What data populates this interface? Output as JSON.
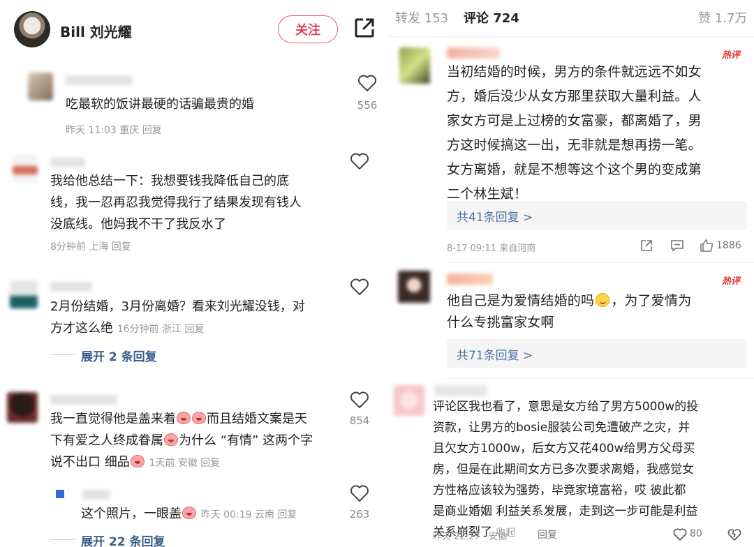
{
  "left": {
    "author": "Bill 刘光耀",
    "follow_label": "关注",
    "comments": [
      {
        "text": "吃最软的饭讲最硬的话骗最贵的婚",
        "meta": "昨天 11:03 重庆 回复",
        "likes": "556"
      },
      {
        "text1": "我给他总结一下：我想要钱我降低自己的底",
        "text2": "线，我一忍再忍我觉得我行了结果发现有钱人",
        "text3": "没底线。他妈我不干了我反水了",
        "meta": "8分钟前 上海 回复"
      },
      {
        "text1": "2月份结婚，3月份离婚？看来刘光耀没钱，对",
        "text2": "方才这么绝",
        "meta": "16分钟前 浙江 回复",
        "expand": "展开 2 条回复"
      },
      {
        "text1a": "我一直觉得他是盖来着",
        "text1b": "而且结婚文案是天",
        "text2a": "下有爱之人终成眷属",
        "text2b": "为什么 “有情” 这两个字",
        "text3": "说不出口 细品",
        "meta": "1天前 安徽 回复",
        "likes": "854"
      },
      {
        "text": "这个照片，一眼盖",
        "meta": "昨天 00:19 云南 回复",
        "likes": "263",
        "expand": "展开 22 条回复"
      }
    ]
  },
  "right": {
    "tabs": {
      "repost": "转发 153",
      "comment": "评论 724",
      "likes": "赞 1.7万"
    },
    "hot_label": "热评",
    "comments": [
      {
        "lines": [
          "当初结婚的时候，男方的条件就远远不如女",
          "方，婚后没少从女方那里获取大量利益。人",
          "家女方可是上过榜的女富豪，都离婚了，男",
          "方这时候搞这一出，无非就是想再捞一笔。",
          "女方离婚，就是不想等这个这个男的变成第",
          "二个林生斌！"
        ],
        "replies": "共41条回复 >",
        "meta": "8-17 09:11 来自河南",
        "likes": "1886"
      },
      {
        "line1a": "他自己是为爱情结婚的吗",
        "line1b": "，为了爱情为",
        "line2": "什么专挑富家女啊",
        "replies": "共71条回复 >"
      },
      {
        "lines": [
          "评论区我也看了，意思是女方给了男方5000w的投",
          "资款，让男方的bosie服装公司免遭破产之灾，并",
          "且欠女方1000w，后女方又花400w给男方父母买",
          "房，但是在此期间女方已多次要求离婚，我感觉女",
          "方性格应该较为强势，毕竟家境富裕，哎 彼此都",
          "是商业婚姻 利益关系发展，走到这一步可能是利益"
        ],
        "last_line": "关系崩裂了",
        "collapse": "收起",
        "meta": "昨天 22:27 · 安徽",
        "reply": "回复",
        "likes": "80"
      }
    ]
  },
  "colors": {
    "accent": "#e0435b",
    "link": "#4d74a6",
    "hot": "#e5332e"
  }
}
